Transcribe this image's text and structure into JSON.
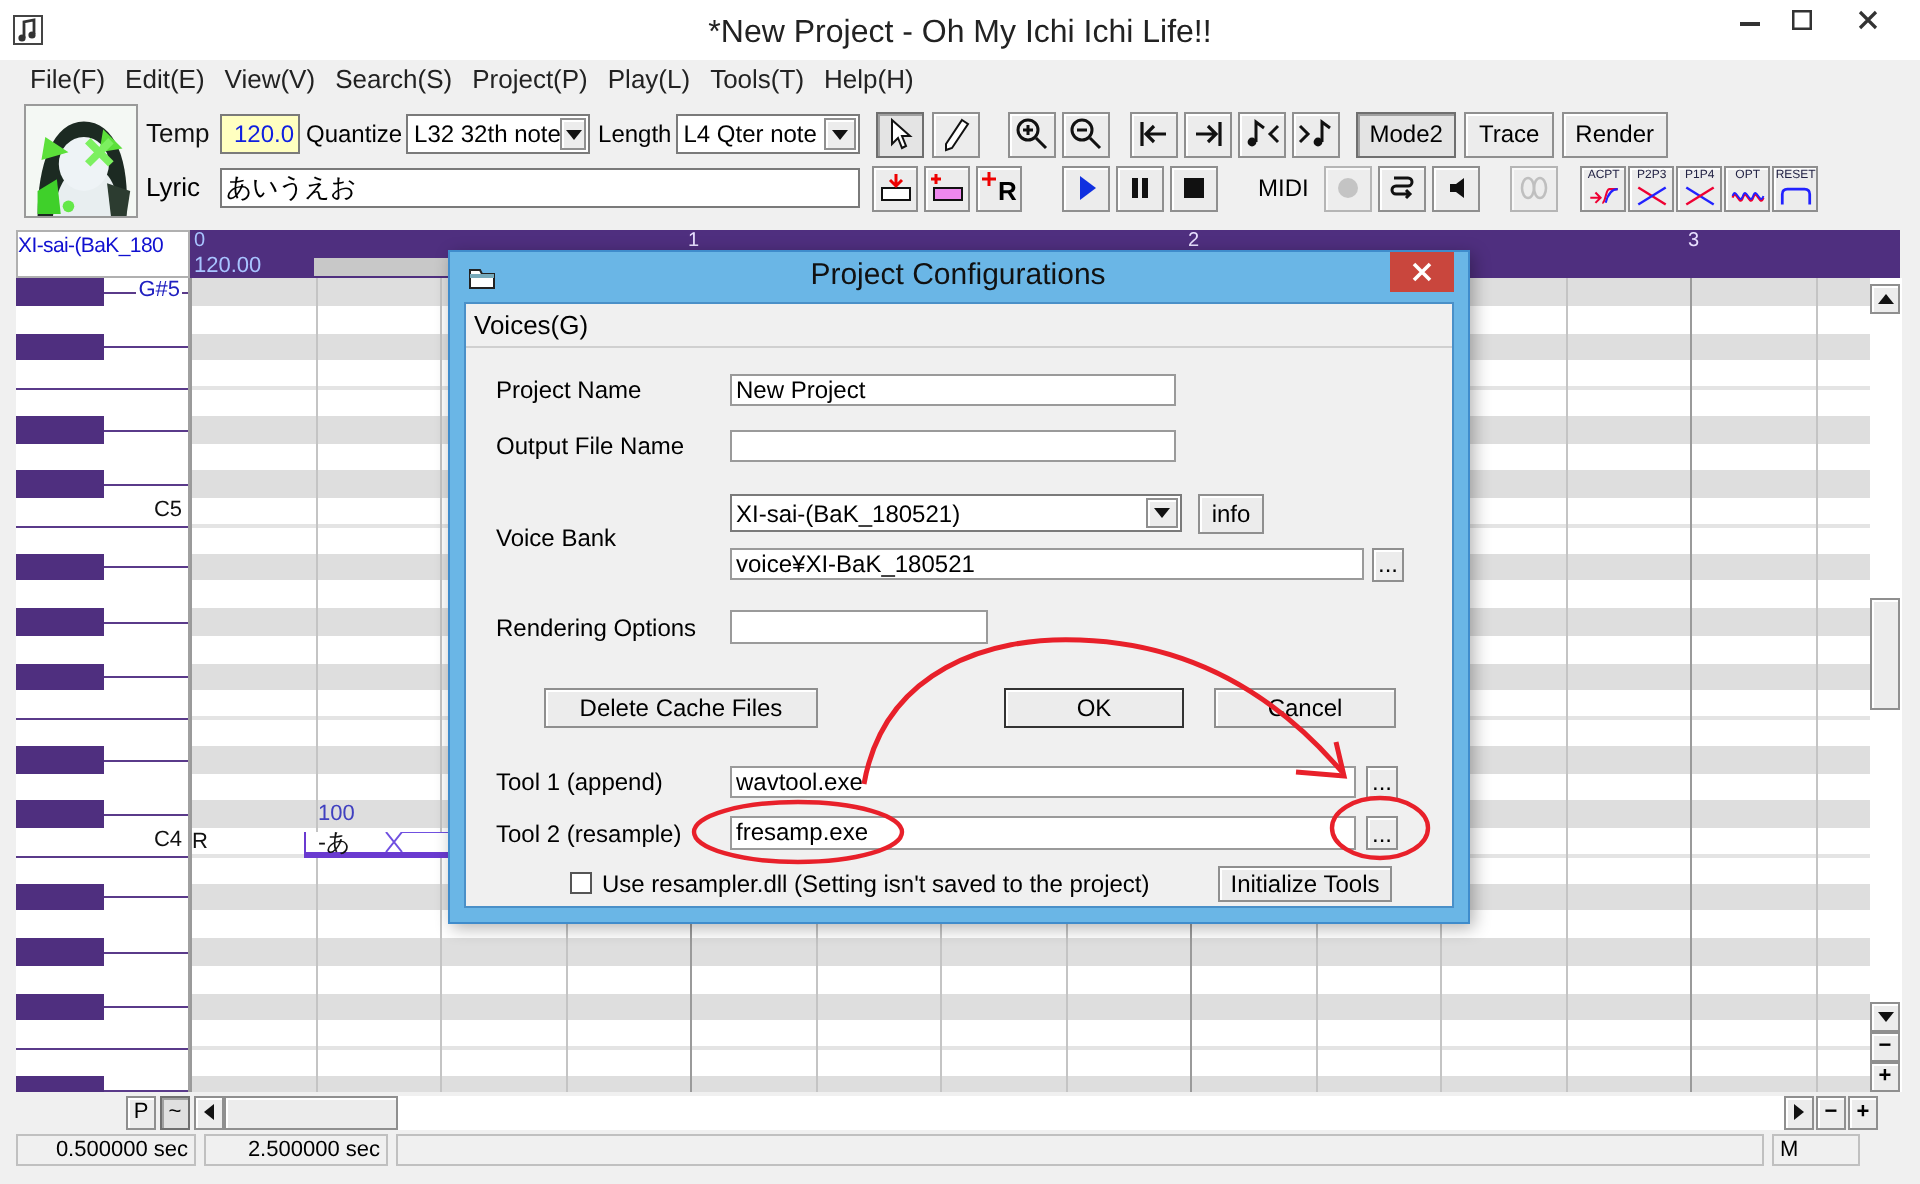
{
  "window": {
    "title": "*New Project - Oh My Ichi Ichi Life!!"
  },
  "menu": [
    "File(F)",
    "Edit(E)",
    "View(V)",
    "Search(S)",
    "Project(P)",
    "Play(L)",
    "Tools(T)",
    "Help(H)"
  ],
  "toolbar": {
    "tempo_label": "Temp",
    "tempo": "120.0",
    "quantize_label": "Quantize",
    "quantize": "L32 32th note",
    "length_label": "Length",
    "length": "L4  Qter note",
    "tools": [
      {
        "kind": "pointer",
        "selected": true
      },
      {
        "kind": "pencil",
        "selected": false
      }
    ],
    "zoom_buttons": [
      {
        "kind": "zoom_in"
      },
      {
        "kind": "zoom_out"
      }
    ],
    "nav_buttons": [
      {
        "kind": "to_start"
      },
      {
        "kind": "to_end"
      },
      {
        "kind": "note_prev"
      },
      {
        "kind": "note_next"
      }
    ],
    "modes": [
      {
        "label": "Mode2",
        "on": true
      },
      {
        "label": "Trace",
        "on": false
      },
      {
        "label": "Render",
        "on": false
      }
    ],
    "lyric_label": "Lyric",
    "lyric": "あいうえお",
    "insert_buttons": [
      {
        "kind": "insert_before"
      },
      {
        "kind": "insert_after"
      },
      {
        "kind": "insert_rest",
        "label": "R"
      }
    ],
    "transport": [
      {
        "kind": "play"
      },
      {
        "kind": "pause"
      },
      {
        "kind": "stop"
      }
    ],
    "midi_label": "MIDI",
    "midi_buttons": [
      {
        "kind": "record",
        "disabled": true
      },
      {
        "kind": "loop",
        "disabled": false
      },
      {
        "kind": "speaker",
        "disabled": false
      },
      {
        "kind": "link",
        "disabled": true
      }
    ],
    "curve_buttons": [
      {
        "kind": "acpt",
        "label": "ACPT"
      },
      {
        "kind": "p2p3",
        "label": "P2P3"
      },
      {
        "kind": "p1p4",
        "label": "P1P4"
      },
      {
        "kind": "opt",
        "label": "OPT"
      },
      {
        "kind": "reset",
        "label": "RESET"
      }
    ]
  },
  "track": {
    "name": "XI-sai-(BaK_180",
    "start": "0",
    "tempo": "120.00",
    "measures": [
      "1",
      "2",
      "3"
    ]
  },
  "piano_roll": {
    "keys": [
      {
        "kind": "black",
        "label": "G#5"
      },
      {
        "kind": "white"
      },
      {
        "kind": "black"
      },
      {
        "kind": "white"
      },
      {
        "kind": "white"
      },
      {
        "kind": "black"
      },
      {
        "kind": "white"
      },
      {
        "kind": "black"
      },
      {
        "kind": "white",
        "label": "C5"
      },
      {
        "kind": "white"
      },
      {
        "kind": "black"
      },
      {
        "kind": "white"
      },
      {
        "kind": "black"
      },
      {
        "kind": "white"
      },
      {
        "kind": "black"
      },
      {
        "kind": "white"
      },
      {
        "kind": "white"
      },
      {
        "kind": "black"
      },
      {
        "kind": "white"
      },
      {
        "kind": "black"
      },
      {
        "kind": "white",
        "label": "C4",
        "marker": "R"
      },
      {
        "kind": "white"
      },
      {
        "kind": "black"
      },
      {
        "kind": "white"
      },
      {
        "kind": "black"
      },
      {
        "kind": "white"
      },
      {
        "kind": "black"
      },
      {
        "kind": "white"
      },
      {
        "kind": "white"
      },
      {
        "kind": "black"
      }
    ],
    "notes": [
      {
        "velocity": "100",
        "lyric": "-あ"
      }
    ]
  },
  "scroll": {
    "bottom_buttons": [
      "P",
      "~"
    ],
    "horizontal_zoom": [
      "−",
      "+"
    ],
    "vertical_zoom": [
      "−",
      "+"
    ]
  },
  "status_bar": {
    "position": "0.500000 sec",
    "length": "2.500000 sec",
    "mode": "M"
  },
  "dialog": {
    "title": "Project Configurations",
    "tab": "Voices(G)",
    "project_name": {
      "label": "Project Name",
      "value": "New Project"
    },
    "output_file_name": {
      "label": "Output File Name"
    },
    "voice_bank": {
      "label": "Voice Bank",
      "value": "XI-sai-(BaK_180521)",
      "info_button": "info",
      "path": "voice¥XI-BaK_180521",
      "browse_button": "..."
    },
    "rendering_options": {
      "label": "Rendering Options"
    },
    "buttons": [
      "Delete Cache Files",
      "OK",
      "Cancel"
    ],
    "tool1": {
      "label": "Tool 1 (append)",
      "value": "wavtool.exe",
      "browse_button": "..."
    },
    "tool2": {
      "label": "Tool 2 (resample)",
      "value": "fresamp.exe",
      "browse_button": "..."
    },
    "use_resampler": {
      "label": "Use resampler.dll (Setting isn't saved to the project)",
      "checked": false
    },
    "initialize_button": "Initialize Tools"
  }
}
